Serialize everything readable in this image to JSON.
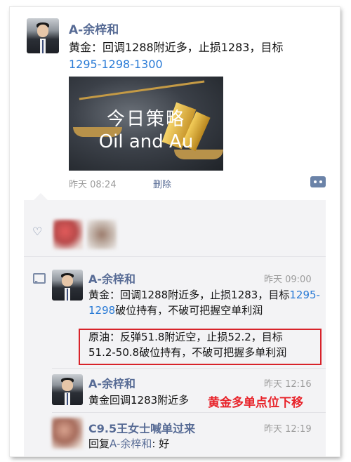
{
  "post": {
    "author": "A-余梓和",
    "text_prefix": "黄金：回调1288附近多，止损1283，目标",
    "text_link": "1295-1298-1300",
    "image": {
      "line1": "今日策略",
      "line2": "Oil and Au"
    },
    "time": "昨天 08:24",
    "delete_label": "删除"
  },
  "likes": {
    "icon": "heart-icon",
    "count_visible": 2
  },
  "comments": [
    {
      "author": "A-余梓和",
      "time": "昨天 09:00",
      "line1_prefix": "黄金：回调1288附近多，止损1283，目标",
      "line1_link": "1295-1298",
      "line1_suffix": "破位持有，不破可把握空单利润",
      "highlight_line1": "原油：反弹51.8附近空，止损52.2，目标",
      "highlight_line2": "51.2-50.8破位持有，不破可把握多单利润"
    },
    {
      "author": "A-余梓和",
      "time": "昨天 12:16",
      "text": "黄金回调1283附近多",
      "annotation": "黄金多单点位下移"
    },
    {
      "author": "C9.5王女士喊单过来",
      "time": "昨天 12:19",
      "reply_prefix": "回复",
      "reply_to": "A-余梓和",
      "reply_text": ": 好"
    }
  ],
  "colors": {
    "name_blue": "#576b95",
    "link_blue": "#2a7bd6",
    "highlight_red": "#d8232a",
    "panel_bg": "#f3f3f5"
  }
}
